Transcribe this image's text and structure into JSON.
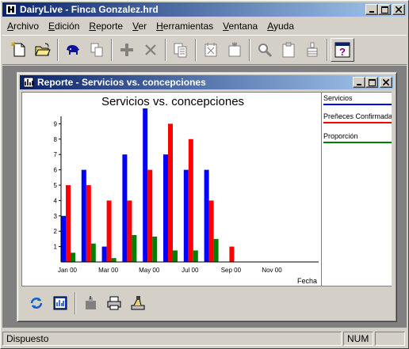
{
  "window": {
    "title": "DairyLive - Finca Gonzalez.hrd"
  },
  "menu": [
    {
      "label": "Archivo",
      "ul": "A",
      "rest": "rchivo"
    },
    {
      "label": "Edición",
      "ul": "E",
      "rest": "dición"
    },
    {
      "label": "Reporte",
      "ul": "R",
      "rest": "eporte"
    },
    {
      "label": "Ver",
      "ul": "V",
      "rest": "er"
    },
    {
      "label": "Herramientas",
      "ul": "H",
      "rest": "erramientas"
    },
    {
      "label": "Ventana",
      "ul": "V",
      "rest": "entana"
    },
    {
      "label": "Ayuda",
      "ul": "A",
      "rest": "yuda"
    }
  ],
  "toolbar": {
    "icons": [
      "new-document-icon",
      "open-folder-icon",
      "find-cow-icon",
      "copy-icon",
      "add-icon",
      "delete-icon",
      "report-icon",
      "event-icon",
      "sparkle-event-icon",
      "search-icon",
      "clipboard-icon",
      "bottle-icon",
      "help-icon"
    ]
  },
  "child": {
    "title": "Reporte - Servicios vs. concepciones"
  },
  "chart_data": {
    "type": "bar",
    "title": "Servicios vs. concepciones",
    "xlabel": "Fecha",
    "ylabel": "",
    "ylim": [
      0,
      10
    ],
    "yticks": [
      1,
      2,
      3,
      4,
      5,
      6,
      7,
      8,
      9
    ],
    "x_tick_labels": [
      "Jan 00",
      "Mar 00",
      "May 00",
      "Jul 00",
      "Sep 00",
      "Nov 00"
    ],
    "categories": [
      "Jan 00",
      "Feb 00",
      "Mar 00",
      "Apr 00",
      "May 00",
      "Jun 00",
      "Jul 00",
      "Aug 00",
      "Sep 00",
      "Oct 00",
      "Nov 00",
      "Dec 00"
    ],
    "series": [
      {
        "name": "Servicios",
        "color": "#0000ff",
        "values": [
          3,
          6,
          1,
          7,
          10,
          7,
          6,
          6,
          0,
          0,
          0,
          0
        ]
      },
      {
        "name": "Preñeces Confirmada",
        "color": "#ff0000",
        "values": [
          5,
          5,
          4,
          4,
          6,
          9,
          8,
          4,
          1,
          0,
          0,
          0
        ]
      },
      {
        "name": "Proporción",
        "color": "#008000",
        "values": [
          0.6,
          1.2,
          0.25,
          1.75,
          1.65,
          0.75,
          0.75,
          1.5,
          0,
          0,
          0,
          0
        ]
      }
    ],
    "legend": "right",
    "grid": false
  },
  "child_toolbar": {
    "icons": [
      "refresh-icon",
      "chart-view-icon",
      "export-icon",
      "print-icon",
      "print-setup-icon"
    ]
  },
  "status": {
    "text": "Dispuesto",
    "num": "NUM"
  }
}
